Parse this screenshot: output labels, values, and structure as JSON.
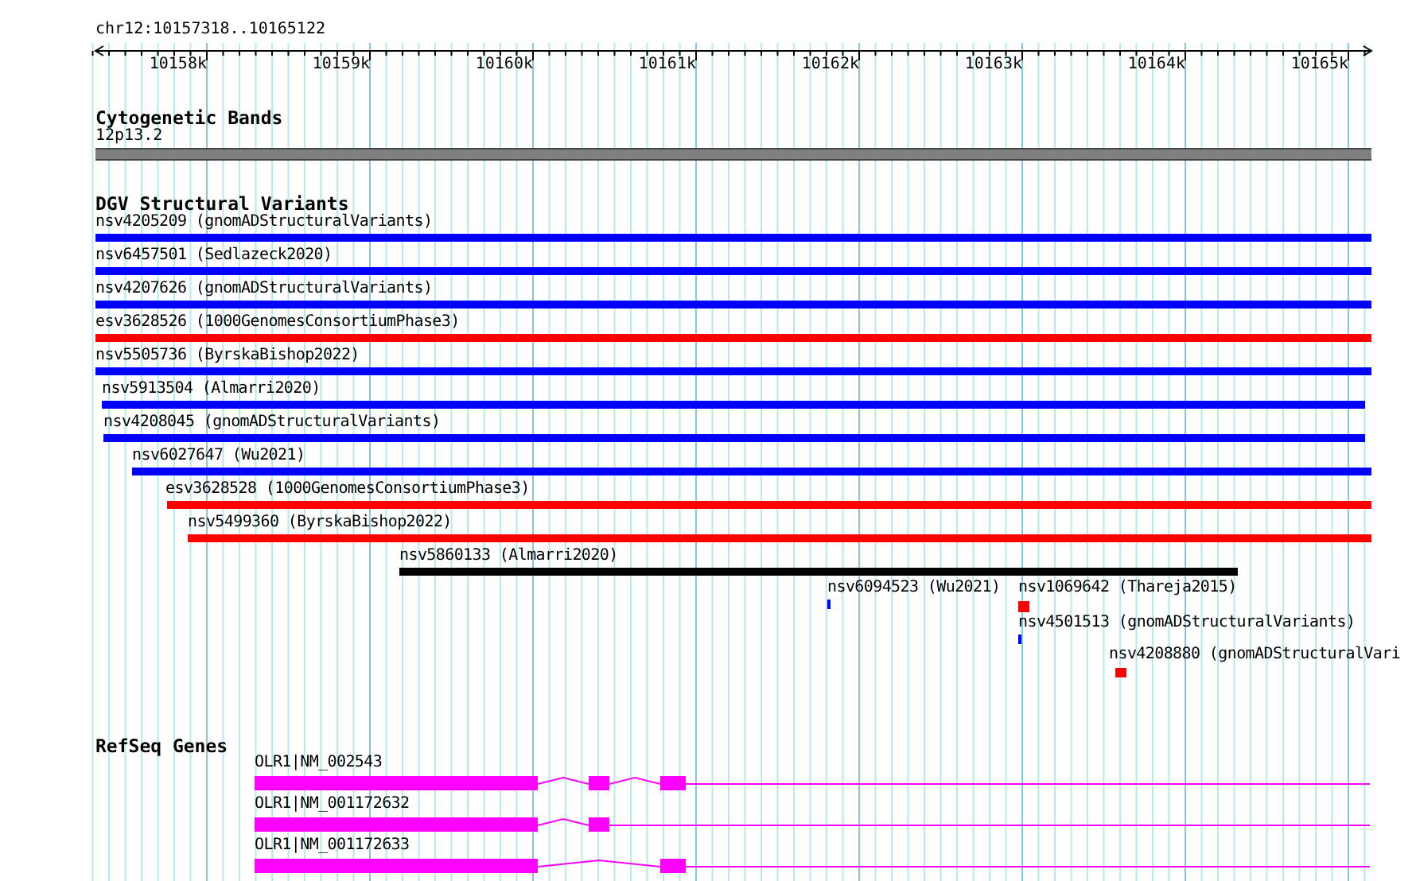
{
  "ruler": {
    "location": "chr12:10157318..10165122",
    "ticks": [
      "10158k",
      "10159k",
      "10160k",
      "10161k",
      "10162k",
      "10163k",
      "10164k",
      "10165k"
    ]
  },
  "tracks": [
    {
      "kind": "bands",
      "title": "Cytogenetic Bands",
      "features": [
        {
          "label": "12p13.2"
        }
      ]
    },
    {
      "kind": "variants",
      "title": "DGV Structural Variants",
      "features": [
        {
          "label": "nsv4205209 (gnomADStructuralVariants)",
          "color": "#0000ff"
        },
        {
          "label": "nsv6457501 (Sedlazeck2020)",
          "color": "#0000ff"
        },
        {
          "label": "nsv4207626 (gnomADStructuralVariants)",
          "color": "#0000ff"
        },
        {
          "label": "esv3628526 (1000GenomesConsortiumPhase3)",
          "color": "#ff0000"
        },
        {
          "label": "nsv5505736 (ByrskaBishop2022)",
          "color": "#0000ff"
        },
        {
          "label": "nsv5913504 (Almarri2020)",
          "color": "#0000ff"
        },
        {
          "label": "nsv4208045 (gnomADStructuralVariants)",
          "color": "#0000ff"
        },
        {
          "label": "nsv6027647 (Wu2021)",
          "color": "#0000ff"
        },
        {
          "label": "esv3628528 (1000GenomesConsortiumPhase3)",
          "color": "#ff0000"
        },
        {
          "label": "nsv5499360 (ByrskaBishop2022)",
          "color": "#ff0000"
        },
        {
          "label": "nsv5860133 (Almarri2020)",
          "color": "#000000"
        },
        {
          "label": "nsv6094523 (Wu2021)",
          "color": "#0000ff"
        },
        {
          "label": "nsv1069642 (Thareja2015)",
          "color": "#ff0000"
        },
        {
          "label": "nsv4501513 (gnomADStructuralVariants)",
          "color": "#0000ff"
        },
        {
          "label": "nsv4208880 (gnomADStructuralVari",
          "color": "#ff0000"
        }
      ]
    },
    {
      "kind": "genes",
      "title": "RefSeq Genes",
      "features": [
        {
          "label": "OLR1|NM_002543"
        },
        {
          "label": "OLR1|NM_001172632"
        },
        {
          "label": "OLR1|NM_001172633"
        }
      ]
    }
  ]
}
